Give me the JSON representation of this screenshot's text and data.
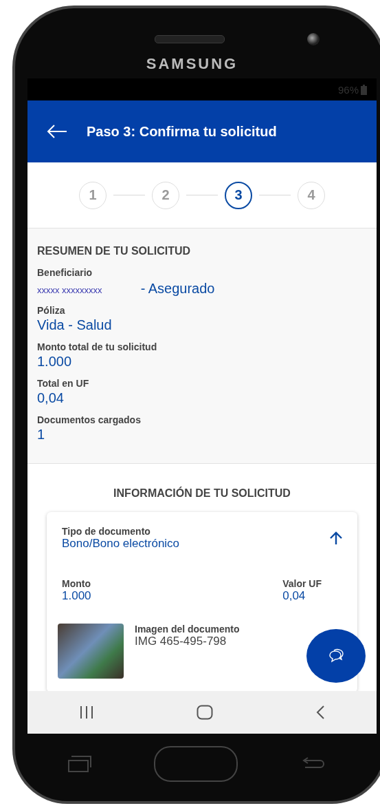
{
  "device": {
    "brand": "SAMSUNG"
  },
  "status_bar": {
    "battery": "96%"
  },
  "app_bar": {
    "title": "Paso 3: Confirma tu solicitud"
  },
  "stepper": [
    {
      "label": "1",
      "selected": false
    },
    {
      "label": "2",
      "selected": false
    },
    {
      "label": "3",
      "selected": true
    },
    {
      "label": "4",
      "selected": false
    }
  ],
  "summary": {
    "title": "RESUMEN DE TU SOLICITUD",
    "fields": [
      {
        "label": "Beneficiario",
        "value": "xxxxx xxxxxxxxx",
        "extra": "- Asegurado"
      },
      {
        "label": "Póliza",
        "value": "Vida - Salud"
      },
      {
        "label": "Monto total de tu solicitud",
        "value": "1.000"
      },
      {
        "label": "Total en UF",
        "value": "0,04"
      },
      {
        "label": "Documentos cargados",
        "value": "1"
      }
    ]
  },
  "info": {
    "title": "INFORMACIÓN DE TU SOLICITUD",
    "card": {
      "expanded": true,
      "type_label": "Tipo de documento",
      "type_value": "Bono/Bono electrónico",
      "amounts": [
        {
          "label": "Monto",
          "value": "1.000"
        },
        {
          "label": "Valor UF",
          "value": "0,04"
        }
      ],
      "image_label": "Imagen del documento",
      "image_name": "IMG 465-495-798"
    }
  }
}
